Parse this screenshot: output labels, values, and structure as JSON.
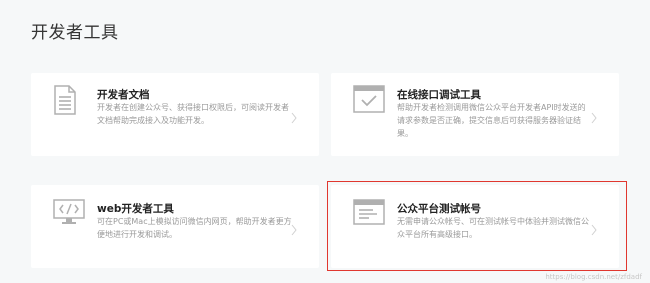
{
  "page": {
    "title": "开发者工具"
  },
  "cards": [
    {
      "name": "开发者文档",
      "desc": "开发者在创建公众号、获得接口权限后，可阅读开发者文档帮助完成接入及功能开发。",
      "icon": "document-icon"
    },
    {
      "name": "在线接口调试工具",
      "desc": "帮助开发者检测调用微信公众平台开发者API时发送的请求参数是否正确，提交信息后可获得服务器验证结果。",
      "icon": "checkbox-window-icon"
    },
    {
      "name": "web开发者工具",
      "desc": "可在PC或Mac上模拟访问微信内网页，帮助开发者更方便地进行开发和调试。",
      "icon": "monitor-code-icon"
    },
    {
      "name": "公众平台测试帐号",
      "desc": "无需申请公众帐号、可在测试帐号中体验并测试微信公众平台所有高级接口。",
      "icon": "browser-window-icon"
    }
  ],
  "watermark": "https://blog.csdn.net/zfdadf"
}
